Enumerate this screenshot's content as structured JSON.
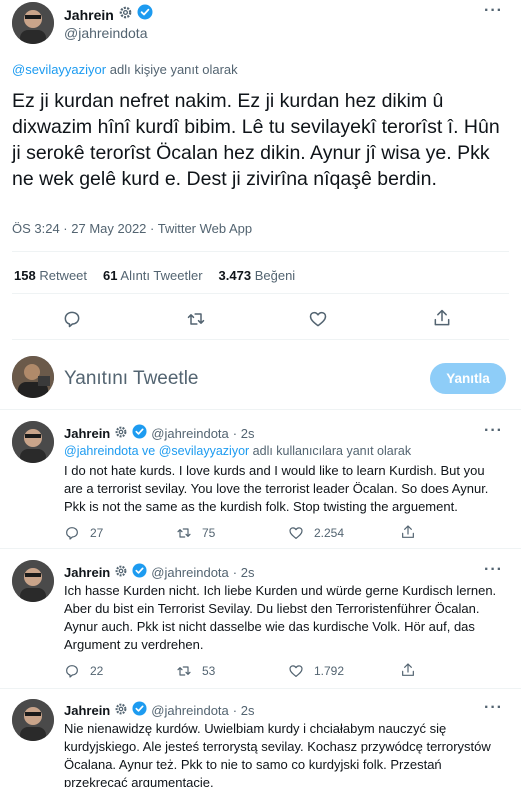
{
  "main_tweet": {
    "name": "Jahrein",
    "handle": "@jahreindota",
    "reply_to_user": "@sevilayyaziyor",
    "reply_to_suffix": "adlı kişiye yanıt olarak",
    "text": "Ez ji kurdan nefret nakim. Ez ji kurdan hez dikim û dixwazim hînî kurdî bibim. Lê tu sevilayekî terorîst î. Hûn ji serokê terorîst Öcalan hez dikin. Aynur jî wisa ye. Pkk ne wek gelê kurd e. Dest ji zivirîna nîqaşê berdin.",
    "meta": "ÖS 3:24 · 27 May 2022 · Twitter Web App",
    "stats": {
      "retweets_count": "158",
      "retweets_label": "Retweet",
      "quotes_count": "61",
      "quotes_label": "Alıntı Tweetler",
      "likes_count": "3.473",
      "likes_label": "Beğeni"
    }
  },
  "compose": {
    "placeholder": "Yanıtını Tweetle",
    "button_label": "Yanıtla"
  },
  "replies": [
    {
      "name": "Jahrein",
      "handle": "@jahreindota",
      "time": "· 2s",
      "reply_to_users": "@jahreindota ve @sevilayyaziyor",
      "reply_to_suffix": "adlı kullanıcılara yanıt olarak",
      "text": "I do not hate kurds. I love kurds and I would like to learn Kurdish. But you are a terrorist sevilay. You love the terrorist leader Öcalan. So does Aynur. Pkk is not the same as the kurdish folk. Stop twisting the arguement.",
      "replies": "27",
      "retweets": "75",
      "likes": "2.254"
    },
    {
      "name": "Jahrein",
      "handle": "@jahreindota",
      "time": "· 2s",
      "text": "Ich hasse Kurden nicht. Ich liebe Kurden und würde gerne Kurdisch lernen. Aber du bist ein Terrorist Sevilay. Du liebst den Terroristenführer Öcalan. Aynur auch. Pkk ist nicht dasselbe wie das kurdische Volk. Hör auf, das Argument zu verdrehen.",
      "replies": "22",
      "retweets": "53",
      "likes": "1.792"
    },
    {
      "name": "Jahrein",
      "handle": "@jahreindota",
      "time": "· 2s",
      "text": "Nie nienawidzę kurdów. Uwielbiam kurdy i chciałabym nauczyć się kurdyjskiego. Ale jesteś terrorystą sevilay. Kochasz przywódcę terrorystów Öcalana. Aynur też. Pkk to nie to samo co kurdyjski folk. Przestań przekręcać argumentację."
    }
  ],
  "colors": {
    "accent": "#1d9bf0",
    "button_disabled": "#8ecdf8",
    "text": "#0f1419",
    "muted": "#536471"
  }
}
